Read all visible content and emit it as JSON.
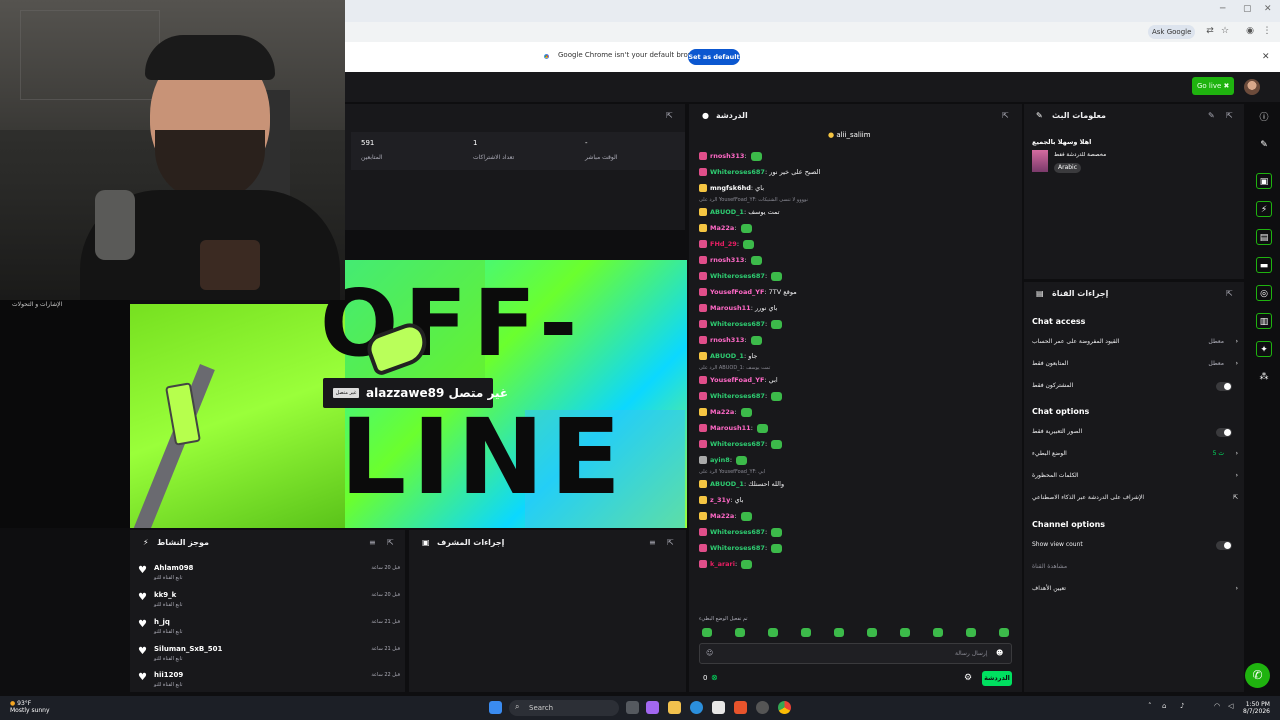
{
  "browser": {
    "ask_google": "Ask Google",
    "notice_text": "Google Chrome isn't your default browser",
    "set_default_label": "Set as default"
  },
  "topbar": {
    "go_live_label": "Go live"
  },
  "stats": [
    {
      "value": "591",
      "label": "المتابعين"
    },
    {
      "value": "1",
      "label": "تعداد الاشتراكات"
    },
    {
      "value": "-",
      "label": "الوقت مباشر"
    }
  ],
  "stream_preview": {
    "offline_line1": "OFF-",
    "offline_line2": "LINE",
    "channel_name": "alazzawe89 غير متصل",
    "offline_tag": "غير متصل"
  },
  "activity": {
    "title": "موجز النشاط",
    "items": [
      {
        "name": "Ahlam098",
        "sub": "تابع القناة للتو",
        "time": "قبل 20 ساعة"
      },
      {
        "name": "kk9_k",
        "sub": "تابع القناة للتو",
        "time": "قبل 20 ساعة"
      },
      {
        "name": "h_jq",
        "sub": "تابع القناة للتو",
        "time": "قبل 21 ساعة"
      },
      {
        "name": "Siluman_SxB_501",
        "sub": "تابع القناة للتو",
        "time": "قبل 21 ساعة"
      },
      {
        "name": "hii1209",
        "sub": "تابع القناة للتو",
        "time": "قبل 22 ساعة"
      }
    ]
  },
  "moderation": {
    "title": "إجراءات المشرف"
  },
  "chat": {
    "title": "الدردشة",
    "pinned": "alii_saliim",
    "input_placeholder": "إرسال رسالة",
    "send_label": "الدردشة",
    "points": "0",
    "emote_notice": "تم تفعيل الوضع البطيء",
    "lines": [
      {
        "user": "rnosh313",
        "color": "#ff69c7",
        "text": ""
      },
      {
        "user": "Whiteroses687",
        "color": "#2ecc71",
        "text": "الصبح على خير نور"
      },
      {
        "user": "mngfsk6hd",
        "color": "#ffffff",
        "text": "باي"
      },
      {
        "user": "ABUOD_1",
        "color": "#2ecc71",
        "text": "تمت يوسف"
      },
      {
        "user": "Ma22a",
        "color": "#ff69c7",
        "text": ""
      },
      {
        "user": "FHd_29",
        "color": "#e91e63",
        "text": ""
      },
      {
        "user": "rnosh313",
        "color": "#ff69c7",
        "text": ""
      },
      {
        "user": "Whiteroses687",
        "color": "#2ecc71",
        "text": ""
      },
      {
        "user": "YousefFoad_YF",
        "color": "#ff69c7",
        "text": "7TV موقع"
      },
      {
        "user": "Maroush11",
        "color": "#ff69c7",
        "text": "باي نورر"
      },
      {
        "user": "Whiteroses687",
        "color": "#2ecc71",
        "text": ""
      },
      {
        "user": "rnosh313",
        "color": "#ff69c7",
        "text": ""
      },
      {
        "user": "ABUOD_1",
        "color": "#2ecc71",
        "text": "جاو"
      },
      {
        "user": "YousefFoad_YF",
        "color": "#ff69c7",
        "text": "ابي"
      },
      {
        "user": "Whiteroses687",
        "color": "#2ecc71",
        "text": ""
      },
      {
        "user": "Ma22a",
        "color": "#ff69c7",
        "text": ""
      },
      {
        "user": "Maroush11",
        "color": "#ff69c7",
        "text": ""
      },
      {
        "user": "Whiteroses687",
        "color": "#2ecc71",
        "text": ""
      },
      {
        "user": "ayin8",
        "color": "#2ecc71",
        "text": ""
      },
      {
        "user": "ABUOD_1",
        "color": "#2ecc71",
        "text": "والله احسنلك"
      },
      {
        "user": "z_31y",
        "color": "#ff69c7",
        "text": "باي"
      },
      {
        "user": "Ma22a",
        "color": "#ff69c7",
        "text": ""
      },
      {
        "user": "Whiteroses687",
        "color": "#2ecc71",
        "text": ""
      },
      {
        "user": "Whiteroses687",
        "color": "#2ecc71",
        "text": ""
      },
      {
        "user": "k_arari",
        "color": "#e91e63",
        "text": ""
      }
    ],
    "replies": [
      "الرد على YousefFoad_YF: نوووو لا تنسى الشتيكات",
      "الرد على ABUOD_1: تمت يوسف",
      "الرد على YousefFoad_YF: ابي"
    ]
  },
  "stream_info": {
    "title": "معلومات البث",
    "stream_title": "اهلا وسهلا بالجميع",
    "category": "مخصصة للدردشة فقط",
    "language_tag": "Arabic"
  },
  "channel_actions": {
    "title": "إجراءات القناة",
    "chat_access": "Chat access",
    "rows_access": [
      {
        "label": "القيود المفروضة على عمر الحساب",
        "value": "معطل"
      },
      {
        "label": "المتابعون فقط",
        "value": "معطل"
      },
      {
        "label": "المشتركون فقط",
        "value": ""
      }
    ],
    "chat_options": "Chat options",
    "rows_options": [
      {
        "label": "الصور التعبيرية فقط",
        "value": ""
      },
      {
        "label": "الوضع البطيء",
        "value": "5 ث"
      },
      {
        "label": "الكلمات المحظورة",
        "value": ""
      },
      {
        "label": "الإشراف على الدردشة عبر الذكاء الاصطناعي",
        "value": ""
      }
    ],
    "channel_options": "Channel options",
    "show_view_count": "Show view count",
    "view_count_sub": "مشاهدة القناة",
    "goals": "تعيين الأهداف"
  },
  "webcam_caption": "الإشارات و التحولات",
  "taskbar": {
    "weather_temp": "93°F",
    "weather_desc": "Mostly sunny",
    "search_placeholder": "Search",
    "time": "1:50 PM",
    "date": "8/7/2026"
  }
}
